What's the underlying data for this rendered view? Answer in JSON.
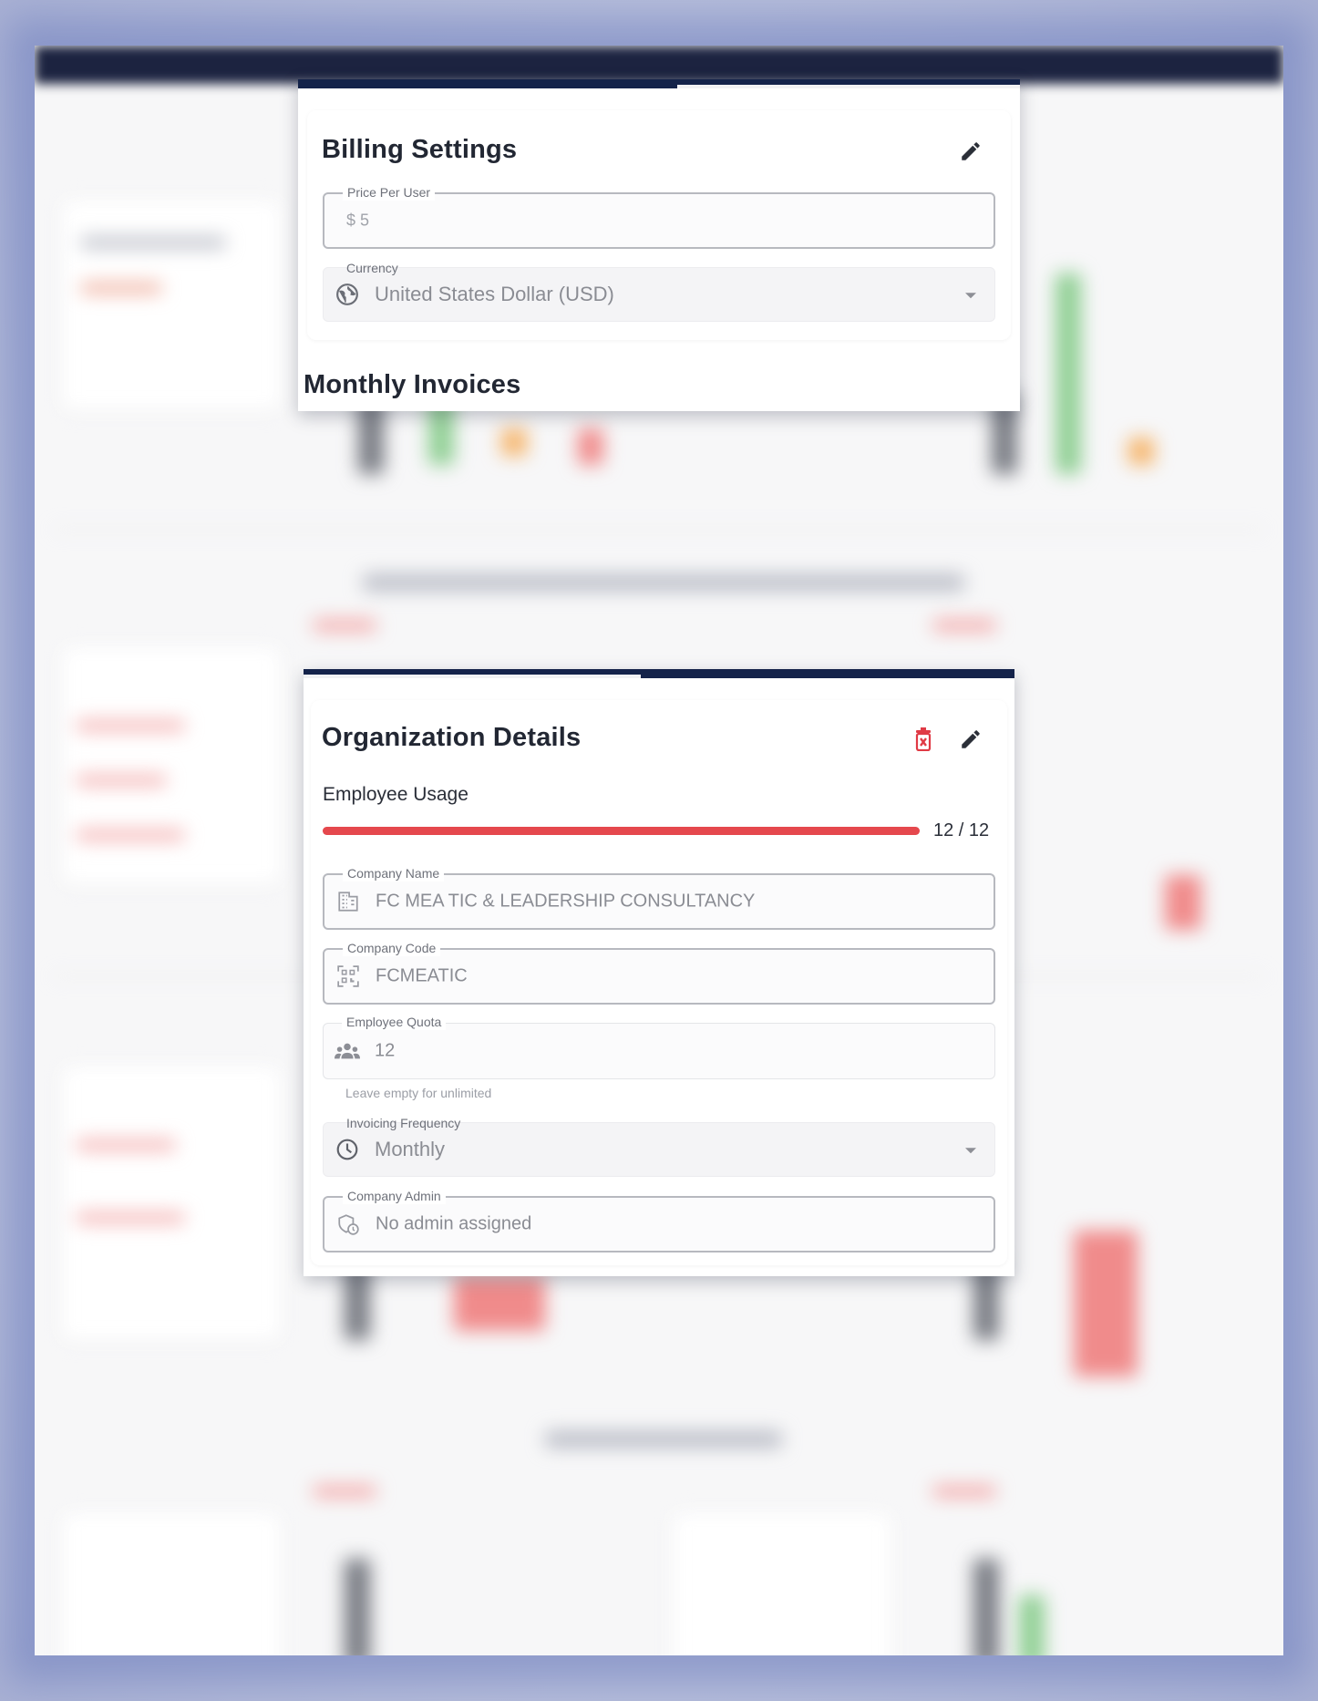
{
  "billing_settings": {
    "title": "Billing Settings",
    "price_per_user": {
      "label": "Price Per User",
      "value": "$ 5"
    },
    "currency": {
      "label": "Currency",
      "value": "United States Dollar (USD)"
    },
    "next_section_title": "Monthly Invoices"
  },
  "organization_details": {
    "title": "Organization Details",
    "employee_usage": {
      "label": "Employee Usage",
      "text": "12 / 12",
      "fraction": 1.0
    },
    "company_name": {
      "label": "Company Name",
      "value": "FC MEA TIC & LEADERSHIP CONSULTANCY"
    },
    "company_code": {
      "label": "Company Code",
      "value": "FCMEATIC"
    },
    "employee_quota": {
      "label": "Employee Quota",
      "value": "12",
      "helper": "Leave empty for unlimited"
    },
    "invoicing_frequency": {
      "label": "Invoicing Frequency",
      "value": "Monthly"
    },
    "company_admin": {
      "label": "Company Admin",
      "value": "No admin assigned"
    }
  },
  "colors": {
    "header_navy": "#14234a",
    "progress_red": "#e5484d",
    "delete_red": "#e03a45"
  },
  "icons": [
    "edit-icon",
    "delete-icon",
    "globe-icon",
    "building-icon",
    "qr-code-icon",
    "group-icon",
    "clock-icon",
    "admin-icon",
    "dropdown-caret-icon"
  ]
}
